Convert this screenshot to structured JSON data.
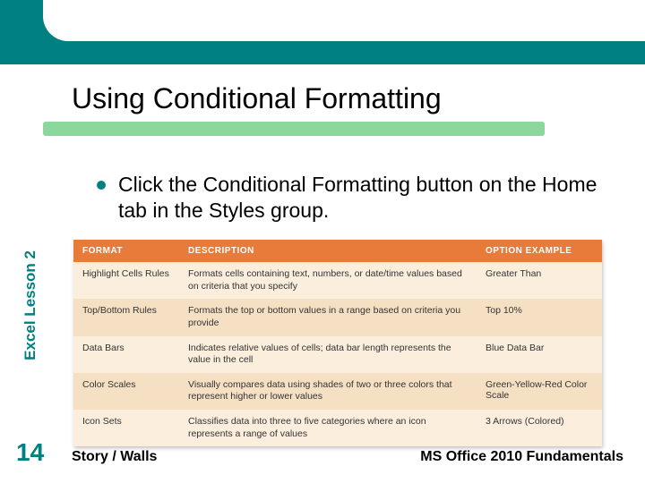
{
  "title": "Using Conditional Formatting",
  "bullet": "Click the Conditional Formatting button on the Home tab in the Styles group.",
  "sidebar_label": "Excel Lesson 2",
  "slide_number": "14",
  "footer_left": "Story / Walls",
  "footer_right": "MS Office 2010 Fundamentals",
  "table": {
    "headers": {
      "format": "FORMAT",
      "description": "DESCRIPTION",
      "example": "OPTION EXAMPLE"
    },
    "rows": [
      {
        "format": "Highlight Cells Rules",
        "description": "Formats cells containing text, numbers, or date/time values based on criteria that you specify",
        "example": "Greater Than"
      },
      {
        "format": "Top/Bottom Rules",
        "description": "Formats the top or bottom values in a range based on criteria you provide",
        "example": "Top 10%"
      },
      {
        "format": "Data Bars",
        "description": "Indicates relative values of cells; data bar length represents the value in the cell",
        "example": "Blue Data Bar"
      },
      {
        "format": "Color Scales",
        "description": "Visually compares data using shades of two or three colors that represent higher or lower values",
        "example": "Green-Yellow-Red Color Scale"
      },
      {
        "format": "Icon Sets",
        "description": "Classifies data into three to five categories where an icon represents a range of values",
        "example": "3 Arrows (Colored)"
      }
    ]
  }
}
